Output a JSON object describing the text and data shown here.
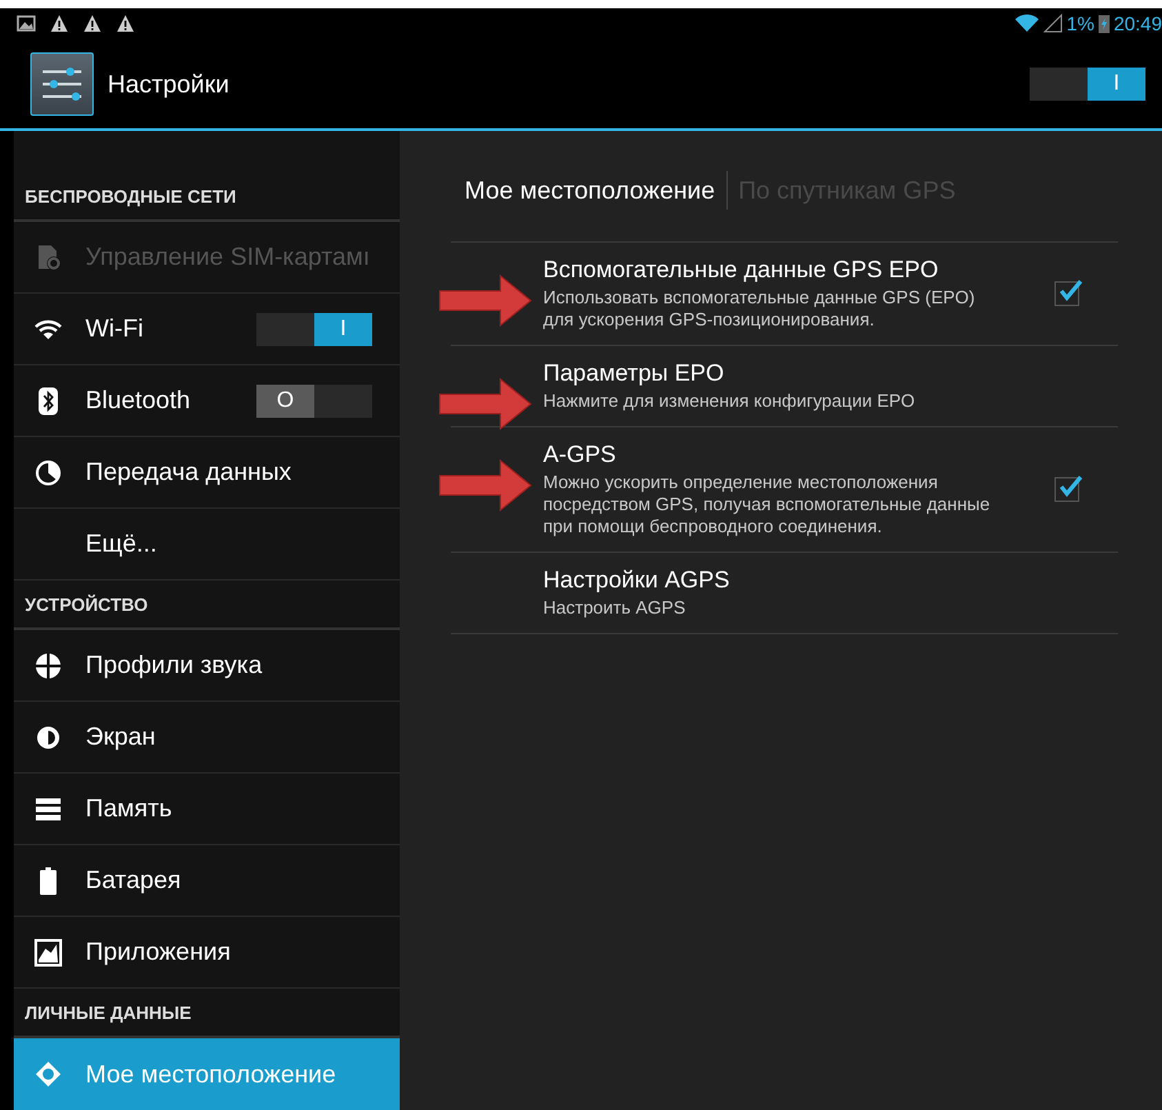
{
  "status_bar": {
    "notifications": [
      {
        "kind": "picture"
      },
      {
        "kind": "warning"
      },
      {
        "kind": "warning"
      },
      {
        "kind": "warning"
      }
    ],
    "battery_text": "1%",
    "time": "20:49"
  },
  "action_bar": {
    "title": "Настройки",
    "master_switch": {
      "on": true,
      "label": "I"
    }
  },
  "sidebar": {
    "sections": [
      {
        "header": "БЕСПРОВОДНЫЕ СЕТИ",
        "items": [
          {
            "label": "Управление SIM-картамı",
            "kind": "sim",
            "disabled": true,
            "selected": false
          },
          {
            "label": "Wi-Fi",
            "kind": "wifi",
            "disabled": false,
            "selected": false,
            "toggle": {
              "on": true,
              "label": "I"
            }
          },
          {
            "label": "Bluetooth",
            "kind": "bluetooth",
            "disabled": false,
            "selected": false,
            "toggle": {
              "on": false,
              "label": "O"
            }
          },
          {
            "label": "Передача данных",
            "kind": "data",
            "disabled": false,
            "selected": false
          },
          {
            "label": "Ещё...",
            "disabled": false,
            "selected": false
          }
        ]
      },
      {
        "header": "УСТРОЙСТВО",
        "items": [
          {
            "label": "Профили звука",
            "kind": "sound",
            "disabled": false,
            "selected": false
          },
          {
            "label": "Экран",
            "kind": "display",
            "disabled": false,
            "selected": false
          },
          {
            "label": "Память",
            "kind": "storage",
            "disabled": false,
            "selected": false
          },
          {
            "label": "Батарея",
            "kind": "battery",
            "disabled": false,
            "selected": false
          },
          {
            "label": "Приложения",
            "kind": "apps",
            "disabled": false,
            "selected": false
          }
        ]
      },
      {
        "header": "ЛИЧНЫЕ ДАННЫЕ",
        "items": [
          {
            "label": "Мое местоположение",
            "kind": "location",
            "disabled": false,
            "selected": true
          }
        ]
      }
    ]
  },
  "breadcrumb": [
    {
      "label": "Мое местоположение",
      "disabled": false
    },
    {
      "label": "По спутникам GPS",
      "disabled": true
    }
  ],
  "preferences": [
    {
      "title": "Вспомогательные данные GPS EPO",
      "summary": "Использовать вспомогательные данные GPS (EPO) для ускорения GPS-позиционирования.",
      "checked": true,
      "arrow": true
    },
    {
      "title": "Параметры EPO",
      "summary": "Нажмите для изменения конфигурации EPO",
      "arrow": true
    },
    {
      "title": "A-GPS",
      "summary": "Можно ускорить определение местоположения посредством GPS, получая вспомогательные данные при помощи беспроводного соединения.",
      "checked": true,
      "arrow": true
    },
    {
      "title": "Настройки AGPS",
      "summary": "Настроить AGPS",
      "arrow": false
    }
  ]
}
